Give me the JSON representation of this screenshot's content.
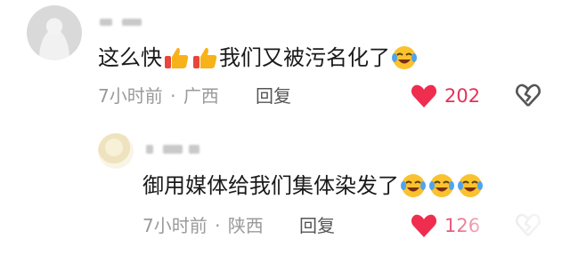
{
  "comment": {
    "text_1": "这么快",
    "text_2": "我们又被污名化了",
    "time": "7小时前",
    "separator": "·",
    "location": "广西",
    "reply_label": "回复",
    "likes": "202",
    "colors": {
      "like": "#e2335a",
      "meta": "#9a9a9a"
    }
  },
  "reply": {
    "text": "御用媒体给我们集体染发了",
    "time": "7小时前",
    "separator": "·",
    "location": "陕西",
    "reply_label": "回复",
    "likes": "126"
  }
}
